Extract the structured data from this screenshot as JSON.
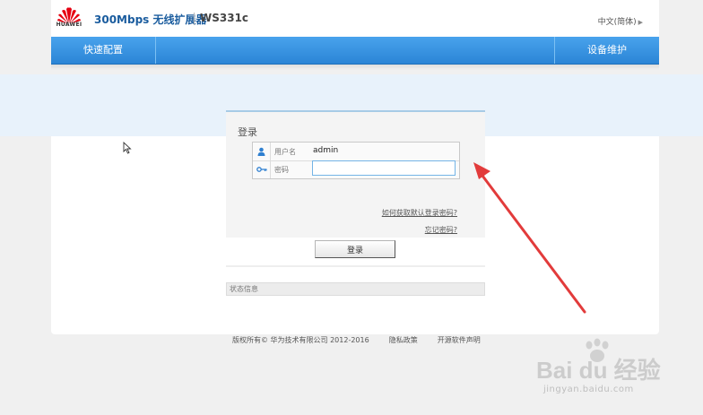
{
  "header": {
    "brand": "HUAWEI",
    "product_name": "300Mbps 无线扩展器",
    "model": "WS331c",
    "language": "中文(简体)"
  },
  "nav": {
    "quick_setup": "快速配置",
    "device_maintenance": "设备维护"
  },
  "login": {
    "title": "登录",
    "username_label": "用户名",
    "username_value": "admin",
    "password_label": "密码",
    "password_value": "",
    "help_link": "如何获取默认登录密码?",
    "forgot_link": "忘记密码?",
    "submit_label": "登录"
  },
  "status": {
    "label": "状态信息"
  },
  "footer": {
    "copyright": "版权所有© 华为技术有限公司 2012-2016",
    "privacy": "隐私政策",
    "open_source": "开源软件声明"
  },
  "watermark": {
    "main": "Bai du 经验",
    "sub": "jingyan.baidu.com"
  },
  "colors": {
    "nav_blue": "#2b85d6",
    "product_blue": "#1a5c9e",
    "brand_red": "#e60012",
    "annotation_arrow": "#e23b3b"
  }
}
